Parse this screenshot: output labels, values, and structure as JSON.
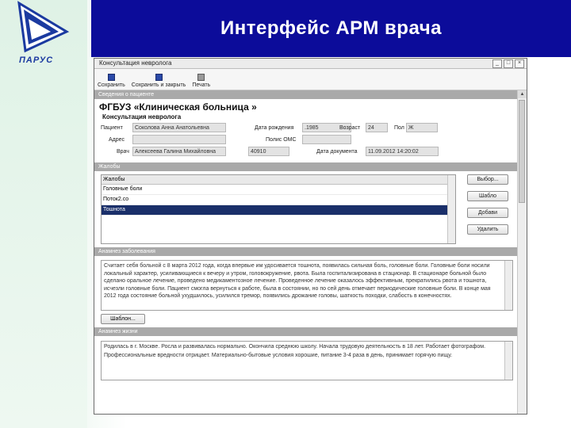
{
  "slide": {
    "title": "Интерфейс АРМ врача",
    "logo_text": "ПАРУС"
  },
  "window": {
    "title": "Консультация невролога",
    "buttons": [
      "_",
      "□",
      "×"
    ]
  },
  "toolbar": {
    "save": "Сохранить",
    "save_close": "Сохранить и закрыть",
    "print": "Печать"
  },
  "patient_section": {
    "header": "Сведения о пациенте",
    "org": "ФГБУЗ «Клиническая больница »",
    "form_title": "Консультация невролога",
    "patient_label": "Пациент",
    "patient_value": "Соколова Анна Анатольевна",
    "address_label": "Адрес",
    "address_value": "",
    "doctor_label": "Врач",
    "doctor_value": "Алексеева Галина Михайловна",
    "doctor_code": "40910",
    "dob_label": "Дата рождения",
    "dob_value": ".1985",
    "age_label": "Возраст",
    "age_value": "24",
    "sex_label": "Пол",
    "sex_value": "Ж",
    "oms_label": "Полис ОМС",
    "oms_value": "",
    "docdate_label": "Дата документа",
    "docdate_value": "11.09.2012 14:20:02"
  },
  "complaints": {
    "header": "Жалобы",
    "column": "Жалобы",
    "items": [
      "Головные боли",
      "Поток2.со",
      "Тошнота"
    ],
    "selected_index": 2,
    "btn_choose": "Выбор...",
    "btn_template": "Шабло",
    "btn_add": "Добави",
    "btn_delete": "Удалить"
  },
  "anamnesis": {
    "header": "Анамнез заболевания",
    "text": "Считает себя больной с 8 марта 2012 года, когда впервые им удосивается тошнота, появилась сильная боль, головные боли. Головные боли носили локальный характер, усиливающиеся к вечеру и утром, головокружение, рвота. Была госпитализирована в стационар. В стационаре больной было сделано оральное лечение, проведено медикаментозное лечение. Проведенное лечение оказалось эффективным, прекратились рвота и тошнота, исчезли головные боли. Пациент смогла вернуться к работе, была в состоянии, но по сей день отмечает периодические головные боли. В конце мая 2012 года состояние больной ухудшилось, усилился тремор, появились дрожание головы, шаткость походки, слабость в конечностях.",
    "btn_template": "Шаблон..."
  },
  "life": {
    "header": "Анамнез жизни",
    "text": "Родилась в г. Москве. Росла и развивалась нормально. Окончила среднюю школу. Начала трудовую деятельность в 18 лет. Работает фотографом. Профессиональные вредности отрицает. Материально-бытовые условия хорошие, питание 3-4 раза в день, принимает горячую пищу."
  }
}
